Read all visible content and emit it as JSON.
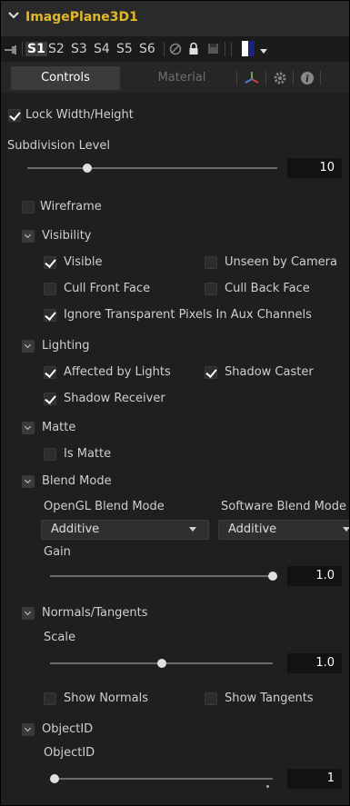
{
  "header": {
    "title": "ImagePlane3D1"
  },
  "slots": {
    "items": [
      "S1",
      "S2",
      "S3",
      "S4",
      "S5",
      "S6"
    ],
    "active": "S1"
  },
  "tabs": {
    "controls": "Controls",
    "material": "Material"
  },
  "controls": {
    "lock_wh": {
      "label": "Lock Width/Height",
      "checked": true
    },
    "subdivision": {
      "label": "Subdivision Level",
      "value": "10",
      "level": 0.24
    },
    "wireframe": {
      "label": "Wireframe",
      "checked": false
    },
    "visibility": {
      "label": "Visibility",
      "visible": {
        "label": "Visible",
        "checked": true
      },
      "unseen_by_camera": {
        "label": "Unseen by Camera",
        "checked": false
      },
      "cull_front": {
        "label": "Cull Front Face",
        "checked": false
      },
      "cull_back": {
        "label": "Cull Back Face",
        "checked": false
      },
      "ignore_transparent": {
        "label": "Ignore Transparent Pixels In Aux Channels",
        "checked": true
      }
    },
    "lighting": {
      "label": "Lighting",
      "affected_by_lights": {
        "label": "Affected by Lights",
        "checked": true
      },
      "shadow_caster": {
        "label": "Shadow Caster",
        "checked": true
      },
      "shadow_receiver": {
        "label": "Shadow Receiver",
        "checked": true
      }
    },
    "matte": {
      "label": "Matte",
      "is_matte": {
        "label": "Is Matte",
        "checked": false
      }
    },
    "blend_mode": {
      "label": "Blend Mode",
      "opengl_label": "OpenGL Blend Mode",
      "software_label": "Software Blend Mode",
      "opengl_value": "Additive",
      "software_value": "Additive",
      "gain_label": "Gain",
      "gain_value": "1.0",
      "gain_level": 1.0
    },
    "normals": {
      "label": "Normals/Tangents",
      "scale_label": "Scale",
      "scale_value": "1.0",
      "scale_level": 0.5,
      "show_normals": {
        "label": "Show Normals",
        "checked": false
      },
      "show_tangents": {
        "label": "Show Tangents",
        "checked": false
      }
    },
    "objectid": {
      "label": "ObjectID",
      "field_label": "ObjectID",
      "value": "1",
      "level": 0.0
    }
  },
  "colors": {
    "title": "#e0b82a",
    "panel_bg": "#1f1f1f"
  }
}
